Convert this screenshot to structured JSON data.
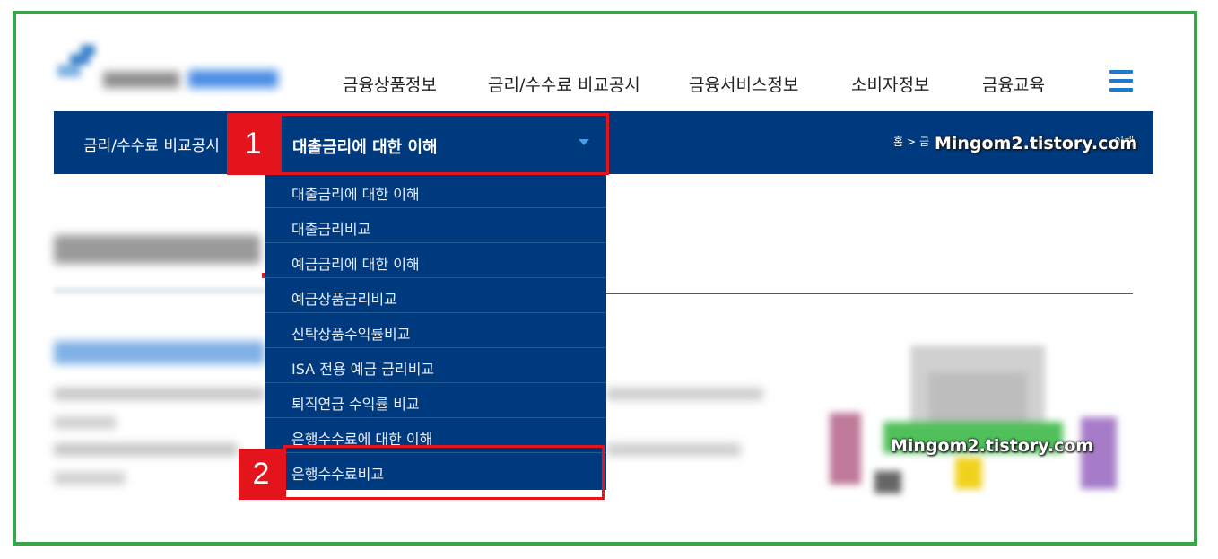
{
  "gnb": {
    "items": [
      "금융상품정보",
      "금리/수수료 비교공시",
      "금융서비스정보",
      "소비자정보",
      "금융교육"
    ]
  },
  "subbar": {
    "title": "금리/수수료 비교공시",
    "selected": "대출금리에 대한 이해",
    "breadcrumb_home": "홈",
    "breadcrumb_sep": ">",
    "breadcrumb_partial": "금",
    "breadcrumb_tail": "이해"
  },
  "watermark": "Mingom2.tistory.com",
  "dropdown": {
    "items": [
      "대출금리에 대한 이해",
      "대출금리비교",
      "예금금리에 대한 이해",
      "예금상품금리비교",
      "신탁상품수익률비교",
      "ISA 전용 예금 금리비교",
      "퇴직연금 수익률 비교",
      "은행수수료에 대한 이해",
      "은행수수료비교"
    ]
  },
  "annotations": {
    "step1": "1",
    "step2": "2"
  },
  "colors": {
    "navy": "#003a7e",
    "accent_blue": "#1e7bc9",
    "red": "#e3141c",
    "frame_green": "#3aa64a"
  },
  "icons": [
    "menu-icon",
    "caret-down-icon",
    "home-icon"
  ]
}
